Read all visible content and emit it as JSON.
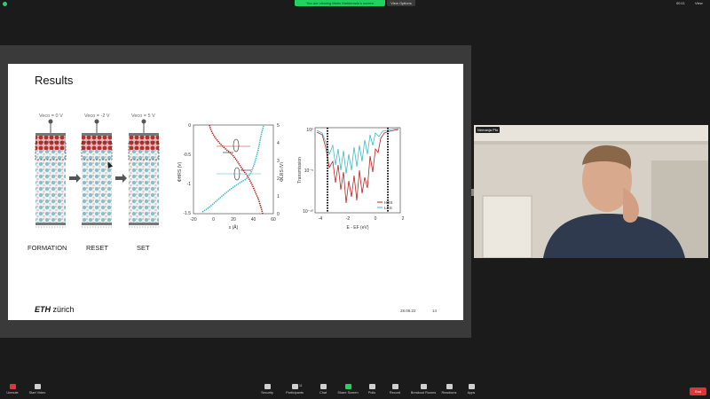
{
  "top": {
    "banner": "You are viewing Mario Maldonado's screen",
    "view_options": "View Options",
    "clock": "00:11",
    "view": "View"
  },
  "slide": {
    "title": "Results",
    "panels": [
      {
        "label": "FORMATION",
        "voltage": "Veco = 0 V"
      },
      {
        "label": "RESET",
        "voltage": "Veco = -2 V"
      },
      {
        "label": "SET",
        "voltage": "Veco = 5 V"
      }
    ],
    "logo_a": "ETH",
    "logo_b": "zürich",
    "date": "28.06.22",
    "page": "14",
    "plot1": {
      "xlabel": "x (Å)",
      "ylabel_left": "ΦHRS (V)",
      "ylabel_right": "ΦLRS (V)",
      "xticks": [
        "-20",
        "0",
        "20",
        "40",
        "60"
      ],
      "yticks_left": [
        "0",
        "-0.5",
        "-1",
        "-1.5"
      ],
      "yticks_right": [
        "5",
        "4",
        "3",
        "2",
        "1",
        "0"
      ]
    },
    "plot2": {
      "xlabel": "E - EF (eV)",
      "ylabel": "Transmission",
      "xticks": [
        "-4",
        "-2",
        "0",
        "2"
      ],
      "yticks": [
        "10⁰",
        "10⁻⁵",
        "10⁻¹⁰"
      ],
      "legend": [
        "HRS",
        "LRS"
      ]
    }
  },
  "camera": {
    "name": "Nemanja Pfo"
  },
  "toolbar": {
    "unmute": "Unmute",
    "start_video": "Start Video",
    "security": "Security",
    "participants": "Participants",
    "participants_count": "11",
    "chat": "Chat",
    "share_screen": "Share Screen",
    "polls": "Polls",
    "record": "Record",
    "breakout": "Breakout Rooms",
    "reactions": "Reactions",
    "apps": "Apps",
    "end": "End"
  },
  "colors": {
    "hrs": "#b5231f",
    "lrs": "#3fb9c3",
    "share_green": "#23d160",
    "end_red": "#d9373c"
  }
}
